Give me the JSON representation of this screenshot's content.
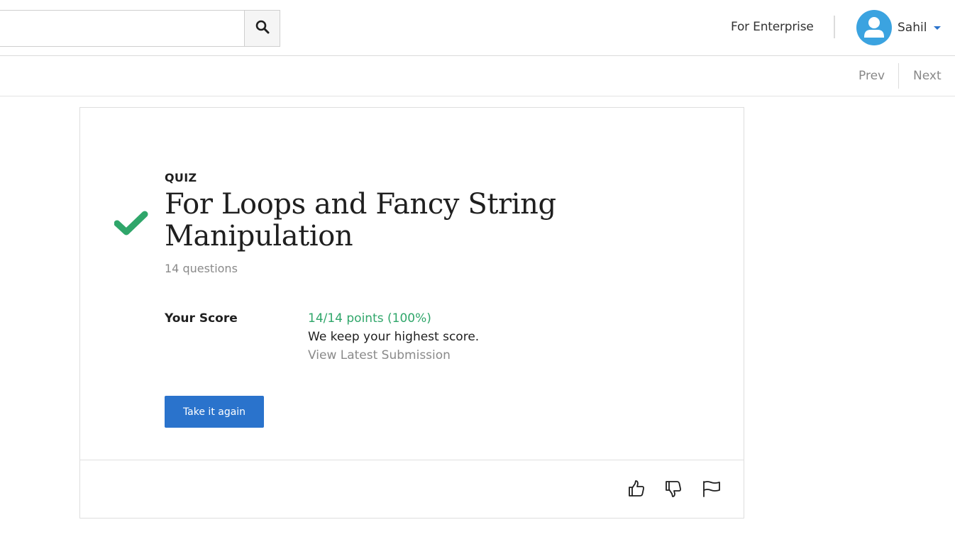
{
  "header": {
    "search": {
      "placeholder": "",
      "value": "",
      "icon": "search-icon"
    },
    "enterprise_link": "For Enterprise",
    "user": {
      "name": "Sahil",
      "avatar_icon": "user-avatar-icon",
      "avatar_color": "#3ba3e0"
    }
  },
  "nav": {
    "prev": "Prev",
    "next": "Next"
  },
  "quiz": {
    "type_label": "QUIZ",
    "title": "For Loops and Fancy String Manipulation",
    "question_count": "14 questions",
    "status_icon": "checkmark-icon",
    "status_color": "#2fa66a",
    "score": {
      "label": "Your Score",
      "value": "14/14 points (100%)",
      "note": "We keep your highest score.",
      "view_latest": "View Latest Submission"
    },
    "retake_button": "Take it again",
    "accent_color": "#2a73cc"
  },
  "feedback": {
    "icons": [
      "thumbs-up-icon",
      "thumbs-down-icon",
      "flag-icon"
    ]
  }
}
